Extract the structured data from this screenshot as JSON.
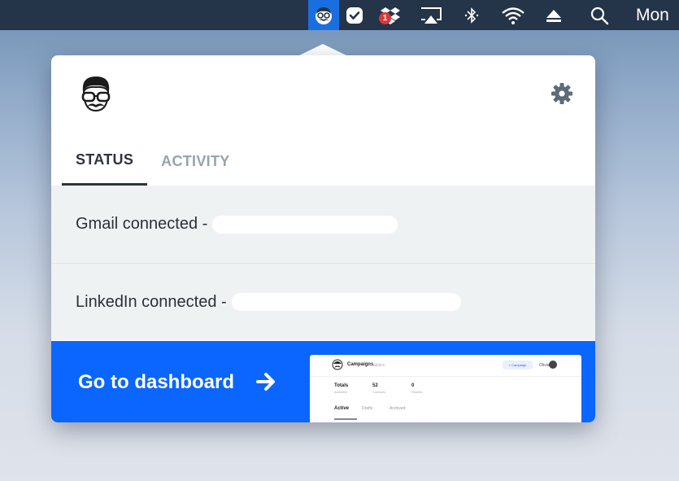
{
  "menubar": {
    "app_icon": "mustache-face-icon",
    "tasks_icon": "check-bubble-icon",
    "dropbox_icon": "dropbox-icon",
    "dropbox_badge": "1",
    "airplay_icon": "airplay-icon",
    "bluetooth_icon": "bluetooth-icon",
    "wifi_icon": "wifi-icon",
    "eject_icon": "eject-icon",
    "search_icon": "search-icon",
    "day": "Mon"
  },
  "popover": {
    "logo_icon": "mustache-face-icon",
    "settings_icon": "gear-icon",
    "tabs": [
      {
        "label": "STATUS",
        "active": true
      },
      {
        "label": "ACTIVITY",
        "active": false
      }
    ],
    "connections": [
      {
        "label": "Gmail connected -"
      },
      {
        "label": "LinkedIn connected -"
      }
    ],
    "cta": {
      "label": "Go to dashboard",
      "arrow_icon": "arrow-right-icon"
    },
    "preview": {
      "title": "Campaigns",
      "subtitle": "Analytics",
      "new_button": "+ Campaign",
      "user": "Olivia",
      "stats": [
        {
          "label": "Totals",
          "sub": "Activities"
        },
        {
          "label": "52",
          "sub": "Contacts"
        },
        {
          "label": "0",
          "sub": "Replies"
        }
      ],
      "tabs": [
        "Active",
        "Drafts",
        "Archived"
      ]
    }
  },
  "colors": {
    "accent": "#0a66ff",
    "menubar_bg": "#243449",
    "row_bg": "#eff2f3"
  }
}
